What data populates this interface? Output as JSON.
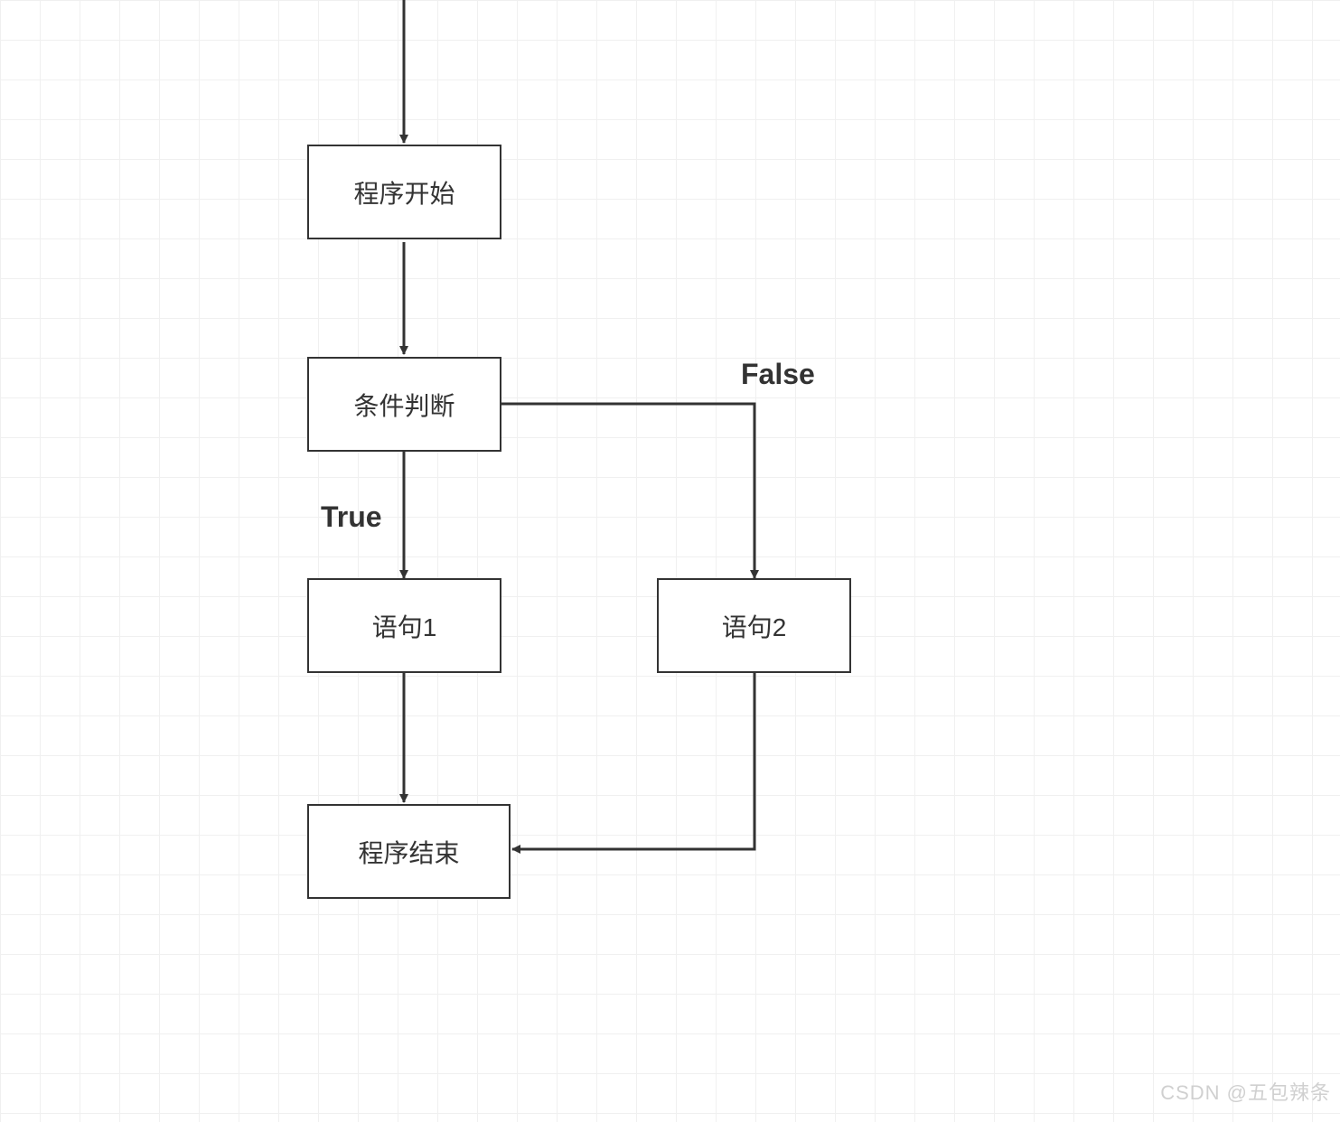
{
  "diagram": {
    "nodes": {
      "start": {
        "label": "程序开始"
      },
      "condition": {
        "label": "条件判断"
      },
      "stmt1": {
        "label": "语句1"
      },
      "stmt2": {
        "label": "语句2"
      },
      "end": {
        "label": "程序结束"
      }
    },
    "edges": {
      "true_label": "True",
      "false_label": "False"
    }
  },
  "watermark": "CSDN @五包辣条"
}
